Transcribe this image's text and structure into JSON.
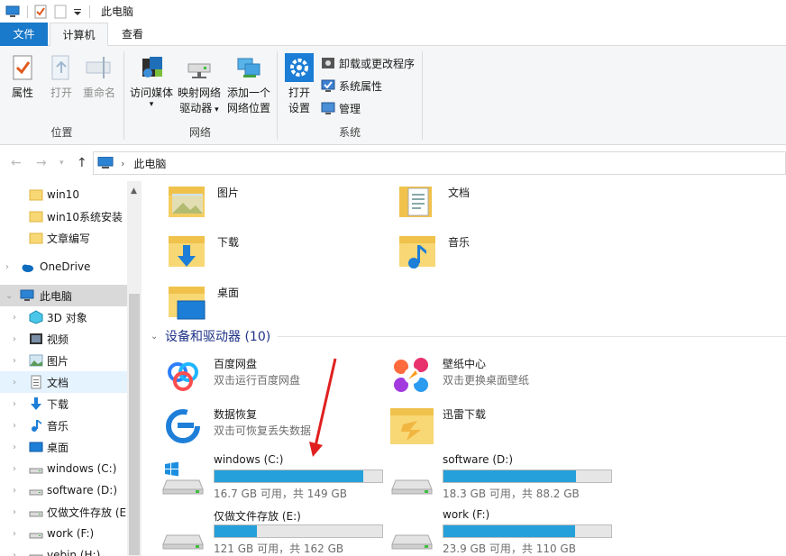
{
  "title_bar": {
    "title": "此电脑"
  },
  "tabs": {
    "file": "文件",
    "computer": "计算机",
    "view": "查看"
  },
  "ribbon": {
    "location_group": {
      "label": "位置",
      "properties": "属性",
      "open": "打开",
      "rename": "重命名"
    },
    "network_group": {
      "label": "网络",
      "access_media_line1": "访问媒体",
      "map_drive_line1": "映射网络",
      "map_drive_line2": "驱动器",
      "add_location_line1": "添加一个",
      "add_location_line2": "网络位置"
    },
    "system_group": {
      "label": "系统",
      "open_settings_line1": "打开",
      "open_settings_line2": "设置",
      "uninstall": "卸载或更改程序",
      "system_properties": "系统属性",
      "manage": "管理"
    }
  },
  "address": {
    "path": "此电脑"
  },
  "nav_pane": {
    "items": [
      {
        "label": "win10",
        "icon": "folder-icon"
      },
      {
        "label": "win10系统安装",
        "icon": "folder-icon"
      },
      {
        "label": "文章编写",
        "icon": "folder-icon"
      },
      {
        "label": "OneDrive",
        "icon": "cloud-icon"
      },
      {
        "label": "此电脑",
        "icon": "computer-icon"
      },
      {
        "label": "3D 对象",
        "icon": "3d-objects-icon"
      },
      {
        "label": "视频",
        "icon": "video-icon"
      },
      {
        "label": "图片",
        "icon": "pictures-icon"
      },
      {
        "label": "文档",
        "icon": "documents-icon"
      },
      {
        "label": "下载",
        "icon": "downloads-icon"
      },
      {
        "label": "音乐",
        "icon": "music-icon"
      },
      {
        "label": "桌面",
        "icon": "desktop-icon"
      },
      {
        "label": "windows (C:)",
        "icon": "drive-icon"
      },
      {
        "label": "software (D:)",
        "icon": "drive-icon"
      },
      {
        "label": "仅做文件存放 (E",
        "icon": "drive-icon"
      },
      {
        "label": "work (F:)",
        "icon": "drive-icon"
      },
      {
        "label": "vebin (H:)",
        "icon": "drive-icon"
      }
    ]
  },
  "folders": [
    {
      "name": "图片"
    },
    {
      "name": "文档"
    },
    {
      "name": "下载"
    },
    {
      "name": "音乐"
    },
    {
      "name": "桌面"
    }
  ],
  "devices_section": {
    "title": "设备和驱动器 (10)"
  },
  "apps": [
    {
      "name": "百度网盘",
      "sub": "双击运行百度网盘"
    },
    {
      "name": "壁纸中心",
      "sub": "双击更换桌面壁纸"
    },
    {
      "name": "数据恢复",
      "sub": "双击可恢复丢失数据"
    },
    {
      "name": "迅雷下载",
      "sub": ""
    }
  ],
  "drives": [
    {
      "name": "windows (C:)",
      "free": "16.7 GB 可用，共 149 GB",
      "used_fraction": 0.888
    },
    {
      "name": "software (D:)",
      "free": "18.3 GB 可用，共 88.2 GB",
      "used_fraction": 0.793
    },
    {
      "name": "仅做文件存放 (E:)",
      "free": "121 GB 可用，共 162 GB",
      "used_fraction": 0.253
    },
    {
      "name": "work (F:)",
      "free": "23.9 GB 可用，共 110 GB",
      "used_fraction": 0.783
    }
  ],
  "colors": {
    "accent": "#1979ca",
    "drive_bar": "#26a0da",
    "annotation": "#e02020"
  }
}
